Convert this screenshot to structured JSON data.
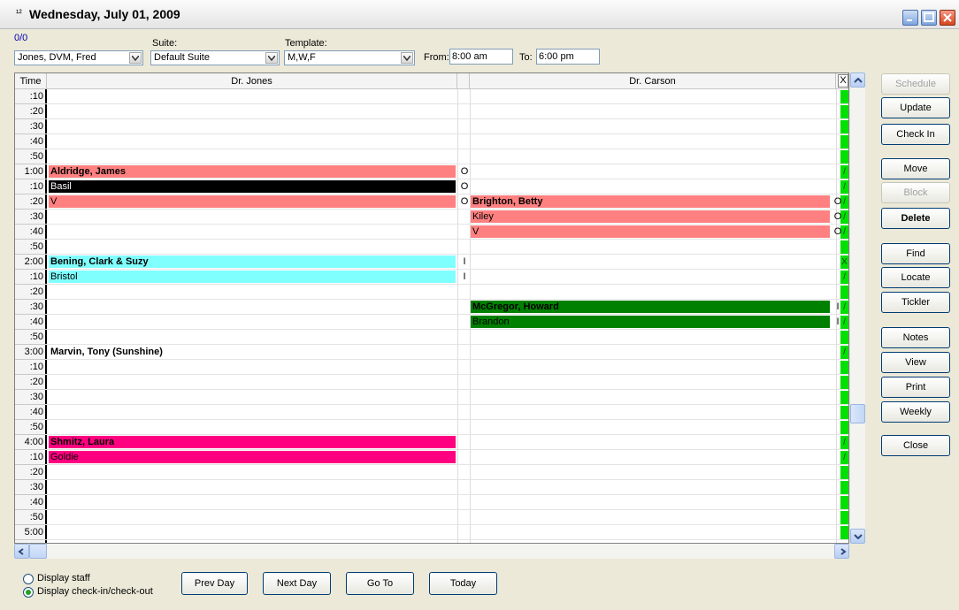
{
  "window": {
    "title": "Wednesday, July 01, 2009",
    "icon": "calendar-icon"
  },
  "toolbar": {
    "counter": "0/0",
    "doctor_value": "Jones, DVM, Fred",
    "suite_label": "Suite:",
    "suite_value": "Default Suite",
    "template_label": "Template:",
    "template_value": "M,W,F",
    "from_label": "From:",
    "from_value": "8:00 am",
    "to_label": "To:",
    "to_value": "6:00 pm"
  },
  "schedule": {
    "time_header": "Time",
    "columns": [
      "Dr. Jones",
      "Dr. Carson"
    ],
    "close_glyph": "X",
    "times": [
      ":10",
      ":20",
      ":30",
      ":40",
      ":50",
      "1:00",
      ":10",
      ":20",
      ":30",
      ":40",
      ":50",
      "2:00",
      ":10",
      ":20",
      ":30",
      ":40",
      ":50",
      "3:00",
      ":10",
      ":20",
      ":30",
      ":40",
      ":50",
      "4:00",
      ":10",
      ":20",
      ":30",
      ":40",
      ":50",
      "5:00"
    ],
    "appointments": [
      {
        "col": 0,
        "row": 5,
        "text": "Aldridge, James",
        "bold": true,
        "bg": "#ff8080",
        "fg": "#000000",
        "mark": "O"
      },
      {
        "col": 0,
        "row": 6,
        "text": "Basil",
        "bold": false,
        "bg": "#000000",
        "fg": "#ffffff",
        "mark": "O"
      },
      {
        "col": 0,
        "row": 7,
        "text": "V",
        "bold": false,
        "bg": "#ff8080",
        "fg": "#000000",
        "mark": "O"
      },
      {
        "col": 1,
        "row": 7,
        "text": "Brighton, Betty",
        "bold": true,
        "bg": "#ff8080",
        "fg": "#000000",
        "mark": "O"
      },
      {
        "col": 1,
        "row": 8,
        "text": "Kiley",
        "bold": false,
        "bg": "#ff8080",
        "fg": "#000000",
        "mark": "O"
      },
      {
        "col": 1,
        "row": 9,
        "text": "V",
        "bold": false,
        "bg": "#ff8080",
        "fg": "#000000",
        "mark": "O"
      },
      {
        "col": 0,
        "row": 11,
        "text": "Bening, Clark & Suzy",
        "bold": true,
        "bg": "#80ffff",
        "fg": "#000000",
        "mark": "I"
      },
      {
        "col": 0,
        "row": 12,
        "text": "Bristol",
        "bold": false,
        "bg": "#80ffff",
        "fg": "#000000",
        "mark": "I"
      },
      {
        "col": 1,
        "row": 14,
        "text": "McGregor, Howard",
        "bold": true,
        "bg": "#008000",
        "fg": "#000000",
        "mark": "I"
      },
      {
        "col": 1,
        "row": 15,
        "text": "Brandon",
        "bold": false,
        "bg": "#008000",
        "fg": "#000000",
        "mark": "I"
      },
      {
        "col": 0,
        "row": 17,
        "text": "Marvin, Tony  (Sunshine)",
        "bold": true,
        "bg": "",
        "fg": "#000000",
        "mark": ""
      },
      {
        "col": 0,
        "row": 23,
        "text": "Shmitz, Laura",
        "bold": true,
        "bg": "#ff0080",
        "fg": "#000000",
        "mark": ""
      },
      {
        "col": 0,
        "row": 24,
        "text": "Goldie",
        "bold": false,
        "bg": "#ff0080",
        "fg": "#000000",
        "mark": ""
      }
    ],
    "status": [
      "",
      "",
      "",
      "",
      "",
      "/",
      "/",
      "/",
      "/",
      "/",
      "",
      "X",
      "/",
      "",
      "/",
      "/",
      "",
      "/",
      "",
      "",
      "",
      "",
      "",
      "/",
      "/",
      "",
      "",
      "",
      "",
      ""
    ]
  },
  "side_buttons": [
    {
      "label": "Schedule",
      "enabled": false,
      "bold": false
    },
    {
      "label": "Update",
      "enabled": true,
      "bold": false
    },
    {
      "label": "Check In",
      "enabled": true,
      "bold": false
    },
    {
      "label": "Move",
      "enabled": true,
      "bold": false
    },
    {
      "label": "Block",
      "enabled": false,
      "bold": false
    },
    {
      "label": "Delete",
      "enabled": true,
      "bold": true
    },
    {
      "label": "Find",
      "enabled": true,
      "bold": false
    },
    {
      "label": "Locate",
      "enabled": true,
      "bold": false
    },
    {
      "label": "Tickler",
      "enabled": true,
      "bold": false
    },
    {
      "label": "Notes",
      "enabled": true,
      "bold": false
    },
    {
      "label": "View",
      "enabled": true,
      "bold": false
    },
    {
      "label": "Print",
      "enabled": true,
      "bold": false
    },
    {
      "label": "Weekly",
      "enabled": true,
      "bold": false
    },
    {
      "label": "Close",
      "enabled": true,
      "bold": false
    }
  ],
  "options": {
    "display_staff": "Display staff",
    "display_checkin": "Display check-in/check-out",
    "selected": "display_checkin"
  },
  "nav": {
    "prev": "Prev Day",
    "next": "Next Day",
    "goto": "Go To",
    "today": "Today"
  }
}
